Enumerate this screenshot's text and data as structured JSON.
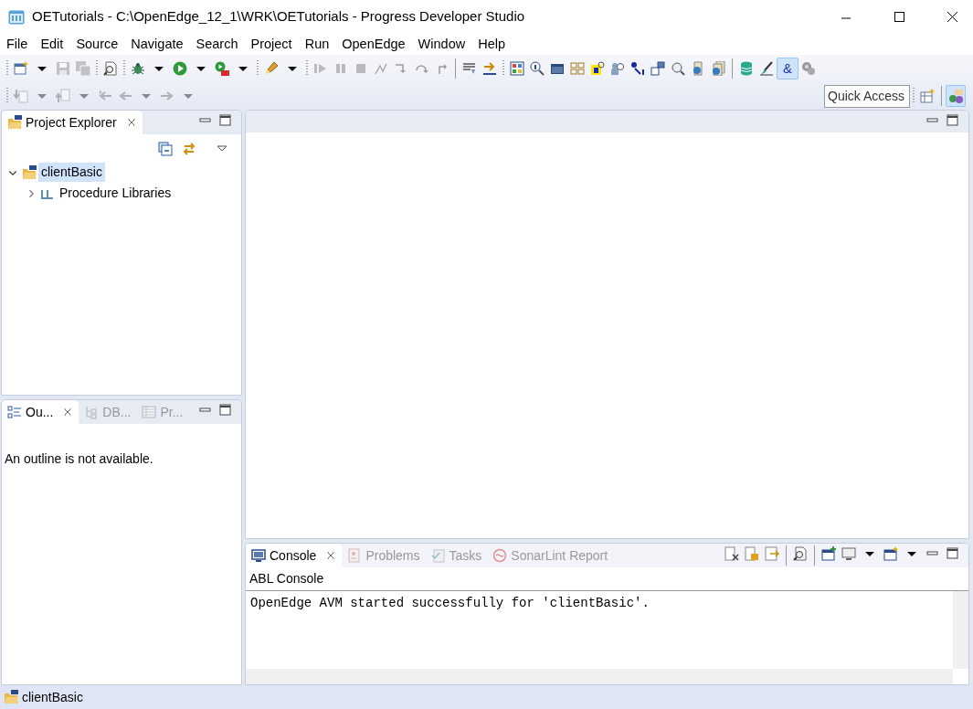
{
  "window": {
    "title": "OETutorials - C:\\OpenEdge_12_1\\WRK\\OETutorials - Progress Developer Studio"
  },
  "menu": [
    "File",
    "Edit",
    "Source",
    "Navigate",
    "Search",
    "Project",
    "Run",
    "OpenEdge",
    "Window",
    "Help"
  ],
  "toolbar_rows": [
    [
      {
        "kind": "separator"
      },
      {
        "kind": "new",
        "disabled": false,
        "pressed": false
      },
      {
        "kind": "caret",
        "disabled": false,
        "pressed": false
      },
      {
        "kind": "save",
        "disabled": true,
        "pressed": false
      },
      {
        "kind": "saveall",
        "disabled": true,
        "pressed": false
      },
      {
        "kind": "separator"
      },
      {
        "kind": "docsearch",
        "disabled": false,
        "pressed": false
      },
      {
        "kind": "separator"
      },
      {
        "kind": "bug",
        "disabled": false,
        "pressed": false
      },
      {
        "kind": "caret",
        "disabled": false,
        "pressed": false
      },
      {
        "kind": "run",
        "disabled": false,
        "pressed": false
      },
      {
        "kind": "caret",
        "disabled": false,
        "pressed": false
      },
      {
        "kind": "runext",
        "disabled": false,
        "pressed": false
      },
      {
        "kind": "caret",
        "disabled": false,
        "pressed": false
      },
      {
        "kind": "separator"
      },
      {
        "kind": "pen",
        "disabled": false,
        "pressed": false
      },
      {
        "kind": "caret",
        "disabled": false,
        "pressed": false
      },
      {
        "kind": "separator"
      },
      {
        "kind": "resume",
        "disabled": true,
        "pressed": false
      },
      {
        "kind": "suspend",
        "disabled": true,
        "pressed": false
      },
      {
        "kind": "stop",
        "disabled": true,
        "pressed": false
      },
      {
        "kind": "disconnect",
        "disabled": true,
        "pressed": false
      },
      {
        "kind": "stepinto",
        "disabled": true,
        "pressed": false
      },
      {
        "kind": "stepover",
        "disabled": true,
        "pressed": false
      },
      {
        "kind": "stepreturn",
        "disabled": true,
        "pressed": false
      },
      {
        "kind": "rule"
      },
      {
        "kind": "wrap",
        "disabled": false,
        "pressed": false
      },
      {
        "kind": "swap",
        "disabled": false,
        "pressed": false
      },
      {
        "kind": "separator"
      },
      {
        "kind": "grid",
        "disabled": false,
        "pressed": false
      },
      {
        "kind": "info",
        "disabled": false,
        "pressed": false
      },
      {
        "kind": "window",
        "disabled": false,
        "pressed": false
      },
      {
        "kind": "layout",
        "disabled": false,
        "pressed": false
      },
      {
        "kind": "badge",
        "disabled": false,
        "pressed": false
      },
      {
        "kind": "person",
        "disabled": false,
        "pressed": false
      },
      {
        "kind": "arrow",
        "disabled": false,
        "pressed": false
      },
      {
        "kind": "windows",
        "disabled": false,
        "pressed": false
      },
      {
        "kind": "search",
        "disabled": false,
        "pressed": false
      },
      {
        "kind": "globe",
        "disabled": false,
        "pressed": false
      },
      {
        "kind": "globes",
        "disabled": false,
        "pressed": false
      },
      {
        "kind": "rule"
      },
      {
        "kind": "database",
        "disabled": false,
        "pressed": false
      },
      {
        "kind": "brush",
        "disabled": false,
        "pressed": false
      },
      {
        "kind": "glyph",
        "text": "&",
        "disabled": false,
        "pressed": true
      },
      {
        "kind": "gears",
        "disabled": false,
        "pressed": false
      }
    ],
    [
      {
        "kind": "separator"
      },
      {
        "kind": "nextann",
        "disabled": true,
        "pressed": false
      },
      {
        "kind": "caret",
        "disabled": true,
        "pressed": false
      },
      {
        "kind": "prevann",
        "disabled": true,
        "pressed": false
      },
      {
        "kind": "caret",
        "disabled": true,
        "pressed": false
      },
      {
        "kind": "lastedit",
        "disabled": true,
        "pressed": false
      },
      {
        "kind": "back",
        "disabled": true,
        "pressed": false
      },
      {
        "kind": "caret",
        "disabled": true,
        "pressed": false
      },
      {
        "kind": "forward",
        "disabled": true,
        "pressed": false
      },
      {
        "kind": "caret",
        "disabled": true,
        "pressed": false
      }
    ]
  ],
  "quick_access": {
    "placeholder": "Quick Access"
  },
  "perspectives": [
    {
      "kind": "open",
      "selected": false
    },
    {
      "kind": "oe",
      "selected": true
    }
  ],
  "project_explorer": {
    "tabs": [
      {
        "label": "Project Explorer",
        "selected": true
      }
    ],
    "tree": [
      {
        "label": "clientBasic",
        "kind": "project",
        "expanded": true,
        "selected": true,
        "children": [
          {
            "label": "Procedure Libraries",
            "kind": "library",
            "expanded": false,
            "selected": false
          }
        ]
      }
    ]
  },
  "outline": {
    "tabs": [
      {
        "label": "Ou...",
        "kind": "outline",
        "selected": true
      },
      {
        "label": "DB...",
        "kind": "dbtree",
        "selected": false
      },
      {
        "label": "Pr...",
        "kind": "table",
        "selected": false
      }
    ],
    "message": "An outline is not available."
  },
  "console": {
    "tabs": [
      {
        "label": "Console",
        "kind": "console",
        "selected": true
      },
      {
        "label": "Problems",
        "kind": "problems",
        "selected": false
      },
      {
        "label": "Tasks",
        "kind": "tasks",
        "selected": false
      },
      {
        "label": "SonarLint Report",
        "kind": "sonar",
        "selected": false
      }
    ],
    "name": "ABL Console",
    "lines": [
      "OpenEdge AVM started successfully for 'clientBasic'."
    ]
  },
  "status_bar": {
    "text": "clientBasic"
  }
}
